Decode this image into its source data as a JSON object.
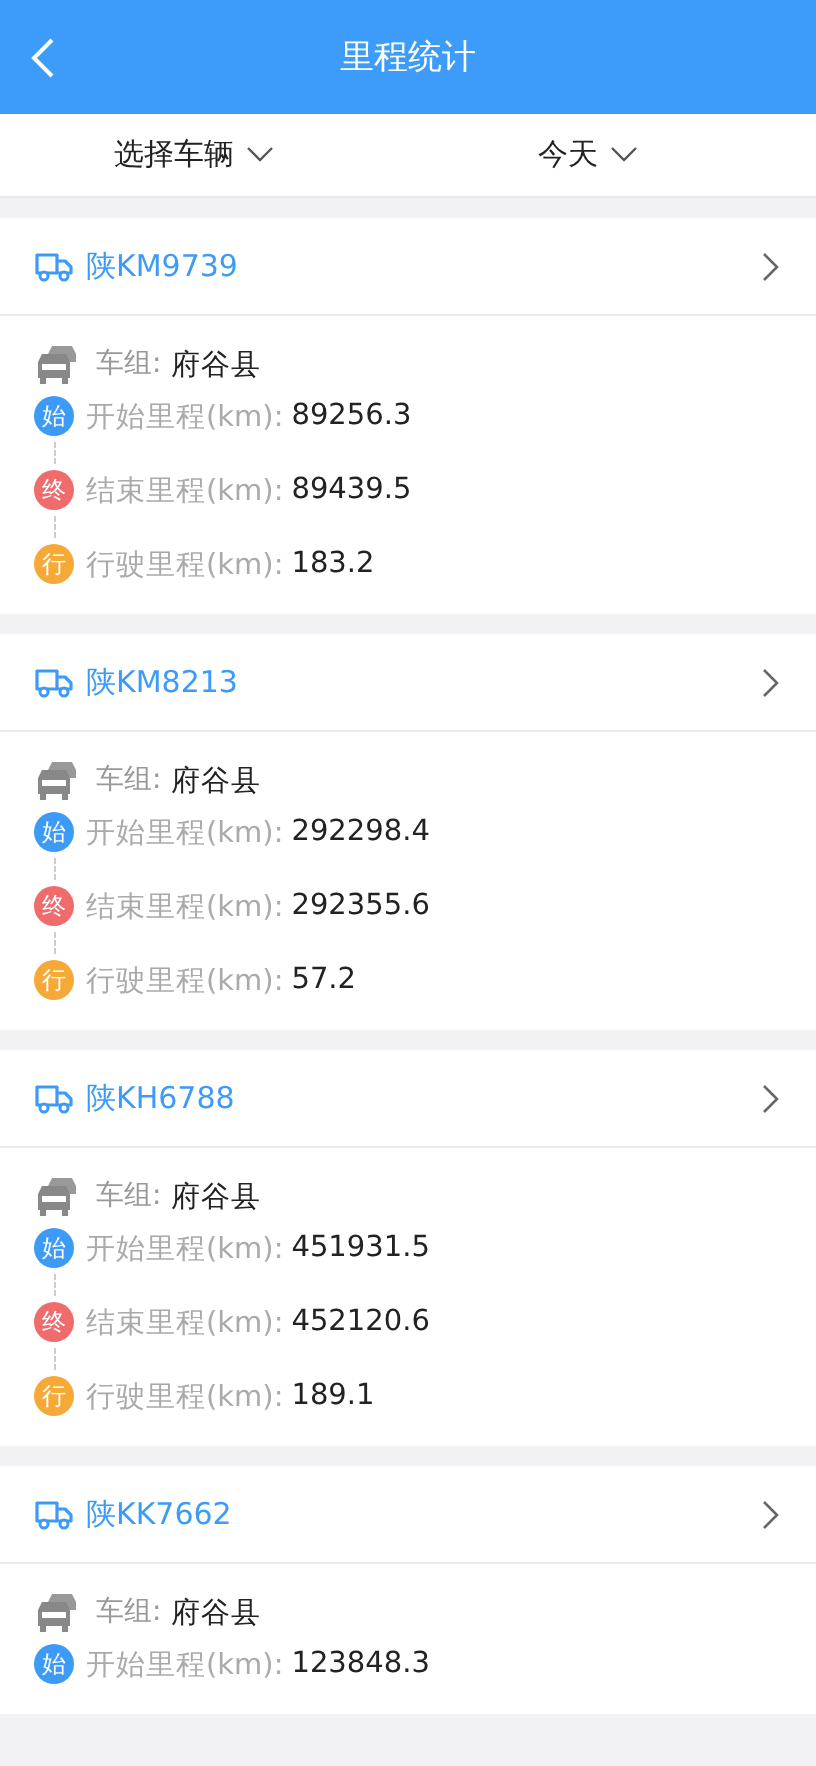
{
  "header": {
    "title": "里程统计"
  },
  "filters": [
    {
      "label": "选择车辆"
    },
    {
      "label": "今天"
    }
  ],
  "vehicles": [
    {
      "plate": "陕KM9739",
      "group_label": "车组:",
      "group": "府谷县",
      "metrics": [
        {
          "kind": "start",
          "badge": "始",
          "label": "开始里程(km):",
          "value": "89256.3"
        },
        {
          "kind": "end",
          "badge": "终",
          "label": "结束里程(km):",
          "value": "89439.5"
        },
        {
          "kind": "drive",
          "badge": "行",
          "label": "行驶里程(km):",
          "value": "183.2"
        }
      ]
    },
    {
      "plate": "陕KM8213",
      "group_label": "车组:",
      "group": "府谷县",
      "metrics": [
        {
          "kind": "start",
          "badge": "始",
          "label": "开始里程(km):",
          "value": "292298.4"
        },
        {
          "kind": "end",
          "badge": "终",
          "label": "结束里程(km):",
          "value": "292355.6"
        },
        {
          "kind": "drive",
          "badge": "行",
          "label": "行驶里程(km):",
          "value": "57.2"
        }
      ]
    },
    {
      "plate": "陕KH6788",
      "group_label": "车组:",
      "group": "府谷县",
      "metrics": [
        {
          "kind": "start",
          "badge": "始",
          "label": "开始里程(km):",
          "value": "451931.5"
        },
        {
          "kind": "end",
          "badge": "终",
          "label": "结束里程(km):",
          "value": "452120.6"
        },
        {
          "kind": "drive",
          "badge": "行",
          "label": "行驶里程(km):",
          "value": "189.1"
        }
      ]
    },
    {
      "plate": "陕KK7662",
      "group_label": "车组:",
      "group": "府谷县",
      "metrics": [
        {
          "kind": "start",
          "badge": "始",
          "label": "开始里程(km):",
          "value": "123848.3"
        }
      ]
    }
  ]
}
